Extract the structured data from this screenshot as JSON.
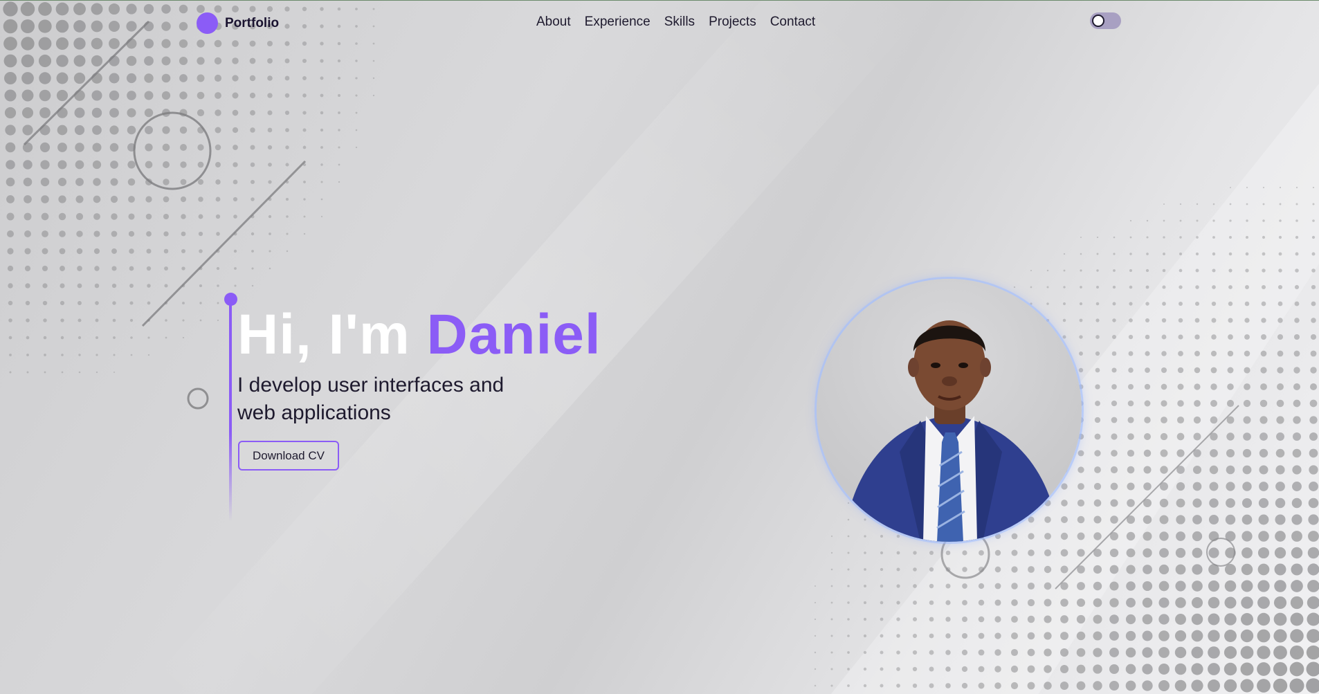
{
  "brand": {
    "name": "Portfolio"
  },
  "nav": {
    "links": [
      "About",
      "Experience",
      "Skills",
      "Projects",
      "Contact"
    ]
  },
  "theme_toggle": {
    "state": "light"
  },
  "hero": {
    "greeting": "Hi, I'm ",
    "name": "Daniel",
    "subtitle": "I develop user interfaces and web applications",
    "cv_button": "Download CV"
  },
  "colors": {
    "accent": "#8b5cf6",
    "text": "#1e1a2e",
    "heading": "#ffffff"
  },
  "icons": {
    "theme": "toggle-switch-icon",
    "portrait": "profile-photo"
  }
}
